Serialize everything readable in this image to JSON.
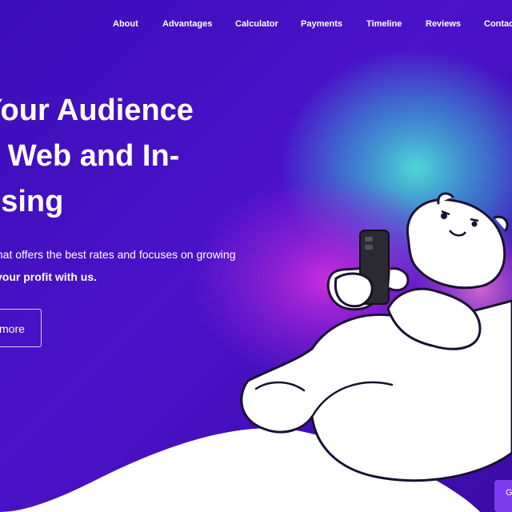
{
  "nav": {
    "items": [
      {
        "label": "About"
      },
      {
        "label": "Advantages"
      },
      {
        "label": "Calculator"
      },
      {
        "label": "Payments"
      },
      {
        "label": "Timeline"
      },
      {
        "label": "Reviews"
      },
      {
        "label": "Contac"
      }
    ]
  },
  "hero": {
    "headline_lines": [
      "Your Audience",
      "e Web and In-",
      "tising"
    ],
    "subtitle_line1": "that offers the best rates and focuses on growing",
    "subtitle_line2": "your profit with us.",
    "cta_label": "more"
  },
  "chat_widget": {
    "label": "G"
  },
  "colors": {
    "hero_purple": "#4a10c8",
    "accent_violet": "#7c3aed",
    "glow_teal": "#3ad6d0",
    "glow_magenta": "#c21fd6"
  },
  "icons": [
    "smartphone-icon",
    "polar-bear-illustration"
  ]
}
